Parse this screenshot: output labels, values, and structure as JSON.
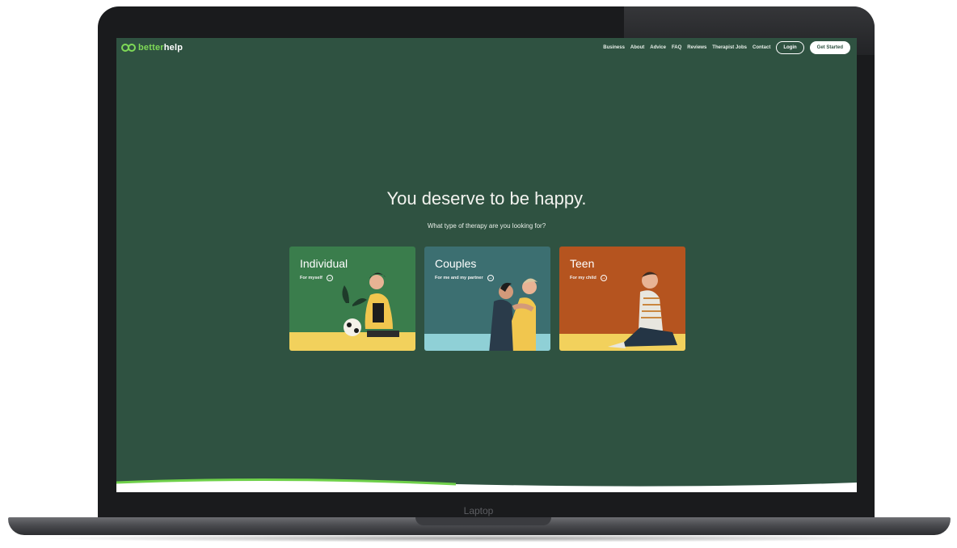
{
  "device": {
    "label": "Laptop"
  },
  "brand": {
    "name_part1": "better",
    "name_part2": "help",
    "accent": "#7ed957",
    "bg": "#2f5241"
  },
  "nav": {
    "links": [
      "Business",
      "About",
      "Advice",
      "FAQ",
      "Reviews",
      "Therapist Jobs",
      "Contact"
    ],
    "login": "Login",
    "get_started": "Get Started"
  },
  "hero": {
    "title": "You deserve to be happy.",
    "subtitle": "What type of therapy are you looking for?"
  },
  "cards": [
    {
      "title": "Individual",
      "subtitle": "For myself",
      "color": "#3a7d4c"
    },
    {
      "title": "Couples",
      "subtitle": "For me and my partner",
      "color": "#3c6f71"
    },
    {
      "title": "Teen",
      "subtitle": "For my child",
      "color": "#b5541f"
    }
  ],
  "icons": [
    "logo-icon",
    "arrow-right-icon"
  ]
}
